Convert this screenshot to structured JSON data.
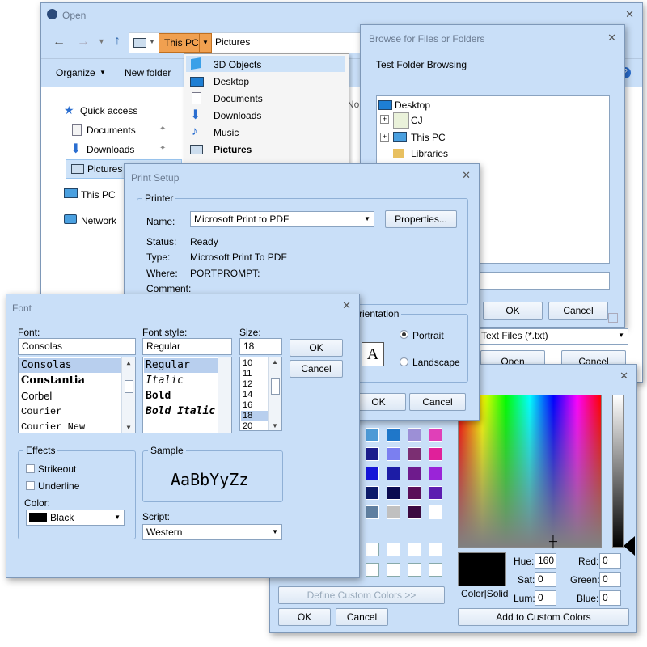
{
  "open": {
    "title": "Open",
    "crumb_pc": "This PC",
    "crumb_folder": "Pictures",
    "organize": "Organize",
    "new_folder": "New folder",
    "nav": [
      "Quick access",
      "Documents",
      "Downloads",
      "Pictures",
      "This PC",
      "Network"
    ],
    "clipped_text": "No",
    "dropdown": [
      "3D Objects",
      "Desktop",
      "Documents",
      "Downloads",
      "Music",
      "Pictures"
    ]
  },
  "browse": {
    "title": "Browse for Files or Folders",
    "subtitle": "Test Folder Browsing",
    "tree": [
      "Desktop",
      "CJ",
      "This PC",
      "Libraries"
    ],
    "ok": "OK",
    "cancel": "Cancel",
    "filter": "Text Files (*.txt)",
    "open_btn": "Open",
    "cancel_btn": "Cancel"
  },
  "print": {
    "title": "Print Setup",
    "group_printer": "Printer",
    "name_label": "Name:",
    "name_value": "Microsoft Print to PDF",
    "properties": "Properties...",
    "status_label": "Status:",
    "status_value": "Ready",
    "type_label": "Type:",
    "type_value": "Microsoft Print To PDF",
    "where_label": "Where:",
    "where_value": "PORTPROMPT:",
    "comment_label": "Comment:",
    "orientation": "rientation",
    "portrait": "Portrait",
    "landscape": "Landscape",
    "ok": "OK",
    "cancel": "Cancel"
  },
  "font": {
    "title": "Font",
    "font_label": "Font:",
    "font_value": "Consolas",
    "fonts": [
      "Consolas",
      "Constantia",
      "Corbel",
      "Courier",
      "Courier New"
    ],
    "style_label": "Font style:",
    "style_value": "Regular",
    "styles": [
      "Regular",
      "Italic",
      "Bold",
      "Bold Italic"
    ],
    "size_label": "Size:",
    "size_value": "18",
    "sizes": [
      "10",
      "11",
      "12",
      "14",
      "16",
      "18",
      "20"
    ],
    "ok": "OK",
    "cancel": "Cancel",
    "effects": "Effects",
    "strikeout": "Strikeout",
    "underline": "Underline",
    "color_label": "Color:",
    "color_value": "Black",
    "sample_label": "Sample",
    "sample_text": "AaBbYyZz",
    "script_label": "Script:",
    "script_value": "Western"
  },
  "color": {
    "define_custom": "Define Custom Colors >>",
    "ok": "OK",
    "cancel": "Cancel",
    "color_solid": "Color|Solid",
    "hue_label": "Hue:",
    "hue": "160",
    "sat_label": "Sat:",
    "sat": "0",
    "lum_label": "Lum:",
    "lum": "0",
    "red_label": "Red:",
    "red": "0",
    "green_label": "Green:",
    "green": "0",
    "blue_label": "Blue:",
    "blue": "0",
    "add_custom": "Add to Custom Colors",
    "basic_swatches": [
      "#4d9ad6",
      "#1f77c9",
      "#9c8fd6",
      "#e040b8",
      "#1c1d8c",
      "#7b7ff0",
      "#7b2f72",
      "#e0209a",
      "#1515d8",
      "#1c1ca5",
      "#6e1b8c",
      "#9a24d8",
      "#0d1b6a",
      "#0a0a50",
      "#5a0f58",
      "#5c1cb0",
      "#5f7fa0",
      "#c0c0c0",
      "#3c0a40",
      "#ffffff"
    ]
  },
  "colors": {
    "window_bg": "#c9dff8",
    "selection": "#b8cfee",
    "dropdown_highlight": "#f0a050"
  }
}
